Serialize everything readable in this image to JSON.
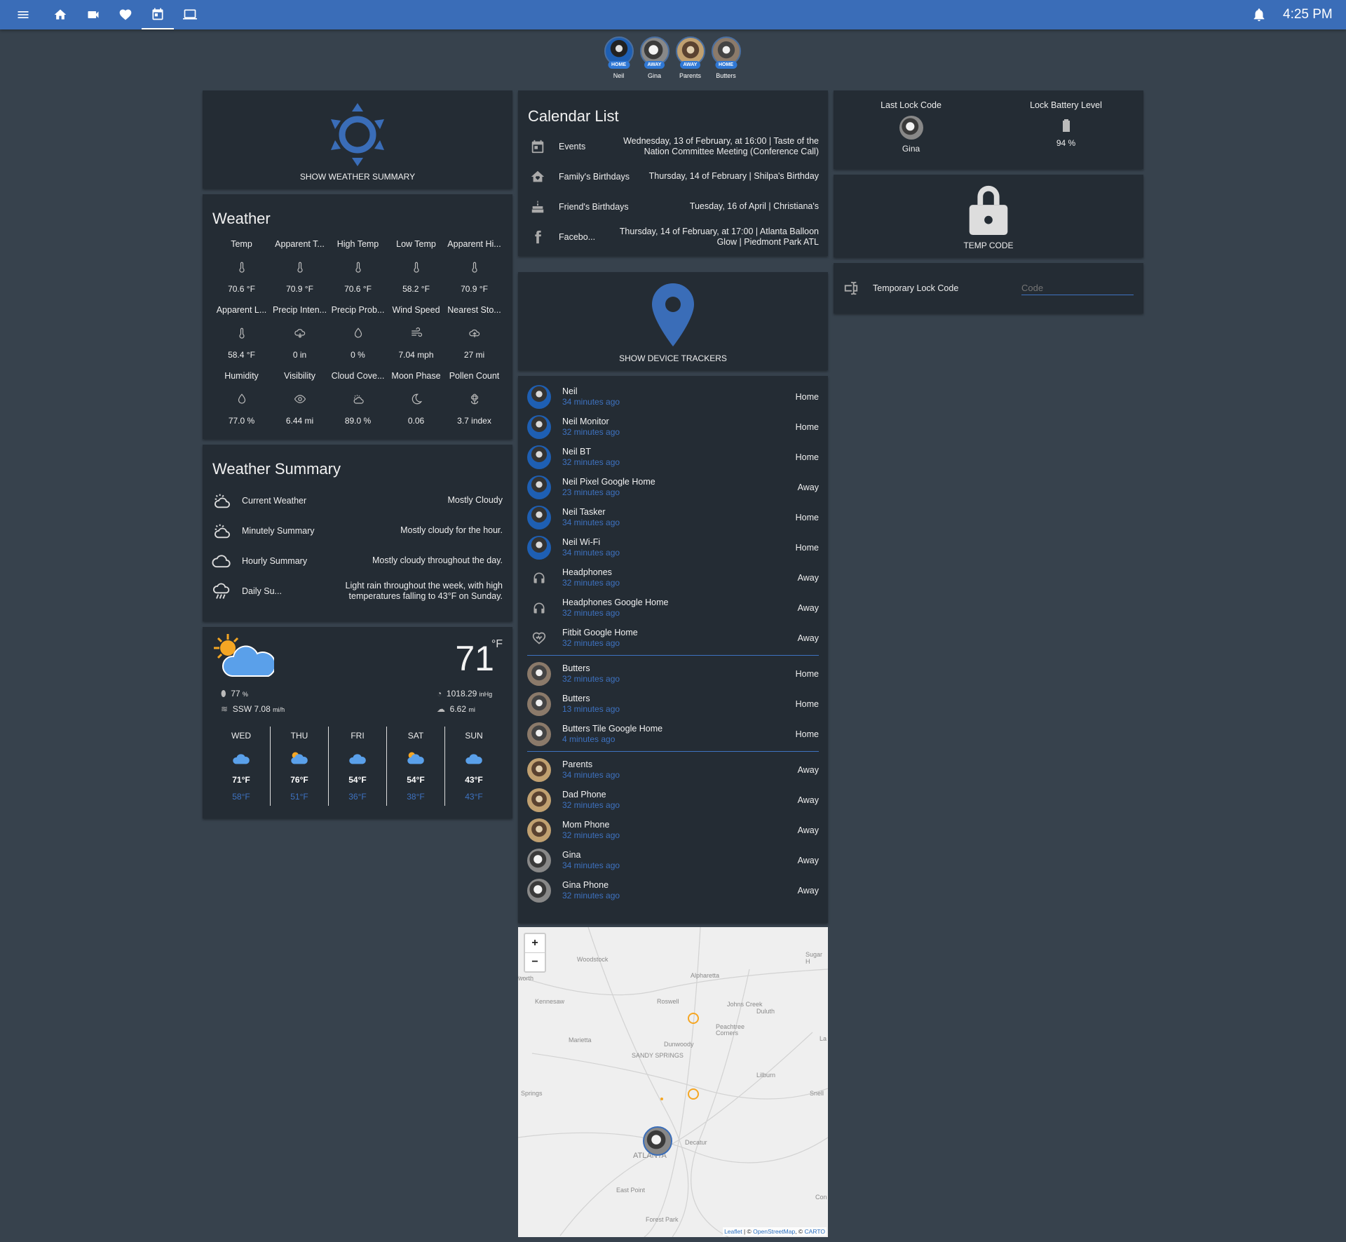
{
  "topbar": {
    "time": "4:25 PM",
    "nav": [
      "menu-icon",
      "home-icon",
      "camera-icon",
      "heart-pulse-icon",
      "calendar-icon",
      "monitor-icon"
    ]
  },
  "persons": [
    {
      "name": "Neil",
      "state": "HOME"
    },
    {
      "name": "Gina",
      "state": "AWAY"
    },
    {
      "name": "Parents",
      "state": "AWAY"
    },
    {
      "name": "Butters",
      "state": "HOME"
    }
  ],
  "weather_summary_button": {
    "label": "SHOW WEATHER SUMMARY"
  },
  "weather": {
    "title": "Weather",
    "items": [
      {
        "name": "Temp",
        "value": "70.6 °F",
        "icon": "thermometer-icon"
      },
      {
        "name": "Apparent T...",
        "value": "70.9 °F",
        "icon": "thermometer-icon"
      },
      {
        "name": "High Temp",
        "value": "70.6 °F",
        "icon": "thermometer-icon"
      },
      {
        "name": "Low Temp",
        "value": "58.2 °F",
        "icon": "thermometer-icon"
      },
      {
        "name": "Apparent Hi...",
        "value": "70.9 °F",
        "icon": "thermometer-icon"
      },
      {
        "name": "Apparent L...",
        "value": "58.4 °F",
        "icon": "thermometer-icon"
      },
      {
        "name": "Precip Inten...",
        "value": "0 in",
        "icon": "cloud-rain-icon"
      },
      {
        "name": "Precip Prob...",
        "value": "0 %",
        "icon": "water-drop-icon"
      },
      {
        "name": "Wind Speed",
        "value": "7.04 mph",
        "icon": "wind-icon"
      },
      {
        "name": "Nearest Sto...",
        "value": "27 mi",
        "icon": "cloud-upload-icon"
      },
      {
        "name": "Humidity",
        "value": "77.0 %",
        "icon": "water-drop-icon"
      },
      {
        "name": "Visibility",
        "value": "6.44 mi",
        "icon": "eye-icon"
      },
      {
        "name": "Cloud Cove...",
        "value": "89.0 %",
        "icon": "partly-cloudy-icon"
      },
      {
        "name": "Moon Phase",
        "value": "0.06",
        "icon": "moon-icon"
      },
      {
        "name": "Pollen Count",
        "value": "3.7 index",
        "icon": "flower-icon"
      }
    ]
  },
  "weather_summary": {
    "title": "Weather Summary",
    "rows": [
      {
        "name": "Current Weather",
        "value": "Mostly Cloudy",
        "icon": "partly-cloudy-icon"
      },
      {
        "name": "Minutely Summary",
        "value": "Mostly cloudy for the hour.",
        "icon": "partly-cloudy-icon"
      },
      {
        "name": "Hourly Summary",
        "value": "Mostly cloudy throughout the day.",
        "icon": "cloud-icon"
      },
      {
        "name": "Daily Su...",
        "value": "Light rain throughout the week, with high temperatures falling to 43°F on Sunday.",
        "icon": "rain-icon"
      }
    ]
  },
  "forecast": {
    "temp": "71",
    "unit": "°F",
    "humidity": "77",
    "humidity_unit": "%",
    "wind": "SSW 7.08",
    "wind_unit": "mi/h",
    "pressure": "1018.29",
    "pressure_unit": "inHg",
    "visibility": "6.62",
    "visibility_unit": "mi",
    "days": [
      {
        "day": "WED",
        "high": "71°F",
        "low": "58°F",
        "icon": "rain-cloud-icon"
      },
      {
        "day": "THU",
        "high": "76°F",
        "low": "51°F",
        "icon": "sun-cloud-icon"
      },
      {
        "day": "FRI",
        "high": "54°F",
        "low": "36°F",
        "icon": "rain-cloud-icon"
      },
      {
        "day": "SAT",
        "high": "54°F",
        "low": "38°F",
        "icon": "sun-cloud-icon"
      },
      {
        "day": "SUN",
        "high": "43°F",
        "low": "43°F",
        "icon": "rain-cloud-icon"
      }
    ]
  },
  "calendar": {
    "title": "Calendar List",
    "rows": [
      {
        "name": "Events",
        "value": "Wednesday, 13 of February, at 16:00 | Taste of the Nation Committee Meeting (Conference Call)",
        "icon": "calendar-icon"
      },
      {
        "name": "Family's Birthdays",
        "value": "Thursday, 14 of February | Shilpa's Birthday",
        "icon": "home-heart-icon"
      },
      {
        "name": "Friend's Birthdays",
        "value": "Tuesday, 16 of April | Christiana's",
        "icon": "cake-icon"
      },
      {
        "name": "Facebo...",
        "value": "Thursday, 14 of February, at 17:00 | Atlanta Balloon Glow | Piedmont Park ATL",
        "icon": "facebook-icon"
      }
    ]
  },
  "device_trackers_button": {
    "label": "SHOW DEVICE TRACKERS"
  },
  "trackers": {
    "groups": [
      [
        {
          "name": "Neil",
          "time": "34 minutes ago",
          "state": "Home",
          "avatar": "neil"
        },
        {
          "name": "Neil Monitor",
          "time": "32 minutes ago",
          "state": "Home",
          "avatar": "neil"
        },
        {
          "name": "Neil BT",
          "time": "32 minutes ago",
          "state": "Home",
          "avatar": "neil"
        },
        {
          "name": "Neil Pixel Google Home",
          "time": "23 minutes ago",
          "state": "Away",
          "avatar": "neil"
        },
        {
          "name": "Neil Tasker",
          "time": "34 minutes ago",
          "state": "Home",
          "avatar": "neil"
        },
        {
          "name": "Neil Wi-Fi",
          "time": "34 minutes ago",
          "state": "Home",
          "avatar": "neil"
        },
        {
          "name": "Headphones",
          "time": "32 minutes ago",
          "state": "Away",
          "icon": "headphones-icon"
        },
        {
          "name": "Headphones Google Home",
          "time": "32 minutes ago",
          "state": "Away",
          "icon": "headphones-icon"
        },
        {
          "name": "Fitbit Google Home",
          "time": "32 minutes ago",
          "state": "Away",
          "icon": "heart-pulse-icon"
        }
      ],
      [
        {
          "name": "Butters",
          "time": "32 minutes ago",
          "state": "Home",
          "avatar": "dog"
        },
        {
          "name": "Butters",
          "time": "13 minutes ago",
          "state": "Home",
          "avatar": "dog"
        },
        {
          "name": "Butters Tile Google Home",
          "time": "4 minutes ago",
          "state": "Home",
          "avatar": "dog"
        }
      ],
      [
        {
          "name": "Parents",
          "time": "34 minutes ago",
          "state": "Away",
          "avatar": "parents"
        },
        {
          "name": "Dad Phone",
          "time": "32 minutes ago",
          "state": "Away",
          "avatar": "parents"
        },
        {
          "name": "Mom Phone",
          "time": "32 minutes ago",
          "state": "Away",
          "avatar": "parents"
        },
        {
          "name": "Gina",
          "time": "34 minutes ago",
          "state": "Away",
          "avatar": "gina"
        },
        {
          "name": "Gina Phone",
          "time": "32 minutes ago",
          "state": "Away",
          "avatar": "gina"
        }
      ]
    ]
  },
  "map": {
    "labels": [
      "Woodstock",
      "Sugar H",
      "Alpharetta",
      "worth",
      "Kennesaw",
      "Roswell",
      "Johns Creek",
      "Duluth",
      "Peachtree Corners",
      "Marietta",
      "Dunwoody",
      "SANDY SPRINGS",
      "La",
      "Lilburn",
      "Springs",
      "Snell",
      "Decatur",
      "ATLANTA",
      "East Point",
      "Con",
      "Forest Park"
    ],
    "zoom_in": "+",
    "zoom_out": "−",
    "attribution_leaflet": "Leaflet",
    "attribution_sep": " | © ",
    "attribution_osm": "OpenStreetMap",
    "attribution_tail": ", © ",
    "attribution_carto": "CARTO"
  },
  "lock": {
    "last_code_title": "Last Lock Code",
    "last_code_value": "Gina",
    "battery_title": "Lock Battery Level",
    "battery_value": "94 %",
    "temp_code_button": "TEMP CODE",
    "temp_code_row_label": "Temporary Lock Code",
    "temp_code_placeholder": "Code"
  },
  "colors": {
    "header": "#3a6db8",
    "accent": "#3e72c0",
    "card": "#242c34",
    "background": "#37424d"
  }
}
